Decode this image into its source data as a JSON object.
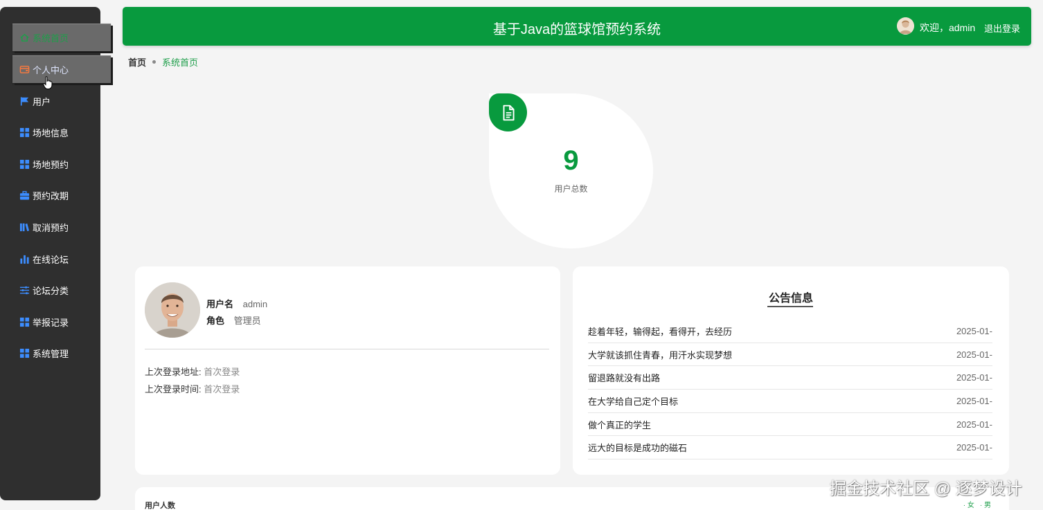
{
  "sidebar": {
    "items": [
      {
        "label": "系统首页",
        "icon": "home-icon"
      },
      {
        "label": "个人中心",
        "icon": "wallet-icon"
      },
      {
        "label": "用户",
        "icon": "flag-icon"
      },
      {
        "label": "场地信息",
        "icon": "grid-icon"
      },
      {
        "label": "场地预约",
        "icon": "grid-icon"
      },
      {
        "label": "预约改期",
        "icon": "briefcase-icon"
      },
      {
        "label": "取消预约",
        "icon": "library-icon"
      },
      {
        "label": "在线论坛",
        "icon": "bar-chart-icon"
      },
      {
        "label": "论坛分类",
        "icon": "sliders-icon"
      },
      {
        "label": "举报记录",
        "icon": "grid-icon"
      },
      {
        "label": "系统管理",
        "icon": "grid-icon"
      }
    ]
  },
  "header": {
    "title": "基于Java的篮球馆预约系统",
    "welcome": "欢迎，admin",
    "logout": "退出登录"
  },
  "breadcrumb": {
    "home": "首页",
    "current": "系统首页"
  },
  "stat": {
    "value": "9",
    "label": "用户总数",
    "icon": "document-icon"
  },
  "profile": {
    "username_label": "用户名",
    "username": "admin",
    "role_label": "角色",
    "role": "管理员",
    "last_login_addr_label": "上次登录地址:",
    "last_login_addr": "首次登录",
    "last_login_time_label": "上次登录时间:",
    "last_login_time": "首次登录"
  },
  "notice": {
    "title": "公告信息",
    "items": [
      {
        "title": "趁着年轻，输得起，看得开，去经历",
        "date": "2025-01-"
      },
      {
        "title": "大学就该抓住青春，用汗水实现梦想",
        "date": "2025-01-"
      },
      {
        "title": "留退路就没有出路",
        "date": "2025-01-"
      },
      {
        "title": "在大学给自己定个目标",
        "date": "2025-01-"
      },
      {
        "title": "做个真正的学生",
        "date": "2025-01-"
      },
      {
        "title": "远大的目标是成功的磁石",
        "date": "2025-01-"
      }
    ]
  },
  "chart": {
    "title": "用户人数",
    "legend": [
      "女",
      "男"
    ]
  },
  "watermark": "掘金技术社区 @ 逐梦设计",
  "colors": {
    "primary": "#089a3e",
    "sidebar_bg": "#2f2f2f",
    "icon_blue": "#3c8dff",
    "icon_orange": "#ff7a3d"
  }
}
